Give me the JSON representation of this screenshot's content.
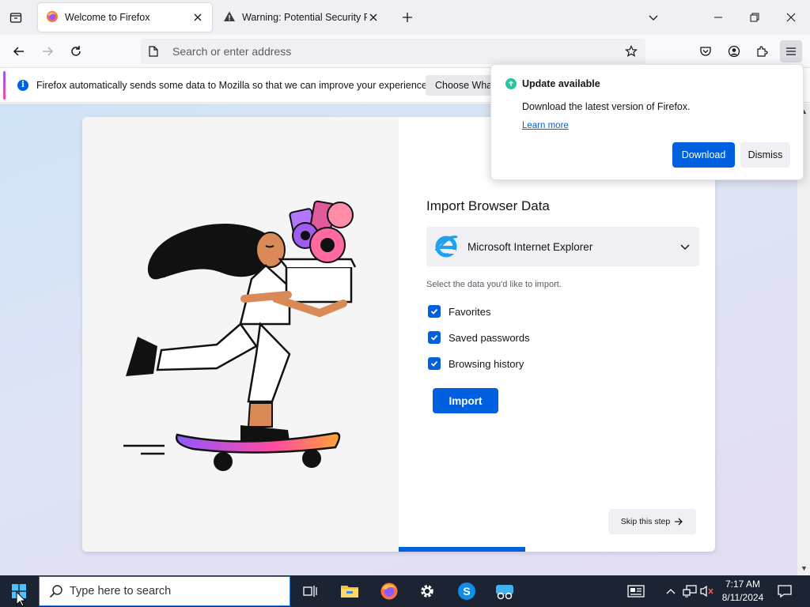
{
  "tabs": [
    {
      "label": "Welcome to Firefox",
      "active": true,
      "icon": "firefox-icon"
    },
    {
      "label": "Warning: Potential Security Risk Ahead",
      "active": false,
      "icon": "warning-icon"
    }
  ],
  "navbar": {
    "address_placeholder": "Search or enter address"
  },
  "notification": {
    "text": "Firefox automatically sends some data to Mozilla so that we can improve your experience.",
    "button_label": "Choose What I Share"
  },
  "update_popup": {
    "title": "Update available",
    "description": "Download the latest version of Firefox.",
    "learn_more": "Learn more",
    "download_label": "Download",
    "dismiss_label": "Dismiss"
  },
  "import": {
    "title": "Import Browser Data",
    "selected_browser": "Microsoft Internet Explorer",
    "hint": "Select the data you'd like to import.",
    "options": [
      {
        "label": "Favorites",
        "checked": true
      },
      {
        "label": "Saved passwords",
        "checked": true
      },
      {
        "label": "Browsing history",
        "checked": true
      }
    ],
    "import_label": "Import",
    "skip_label": "Skip this step",
    "progress_fraction": 0.4
  },
  "taskbar": {
    "search_placeholder": "Type here to search",
    "time": "7:17 AM",
    "date": "8/11/2024"
  },
  "colors": {
    "accent": "#0060df",
    "taskbar": "#1c2433",
    "update_green": "#2ac3a2"
  }
}
